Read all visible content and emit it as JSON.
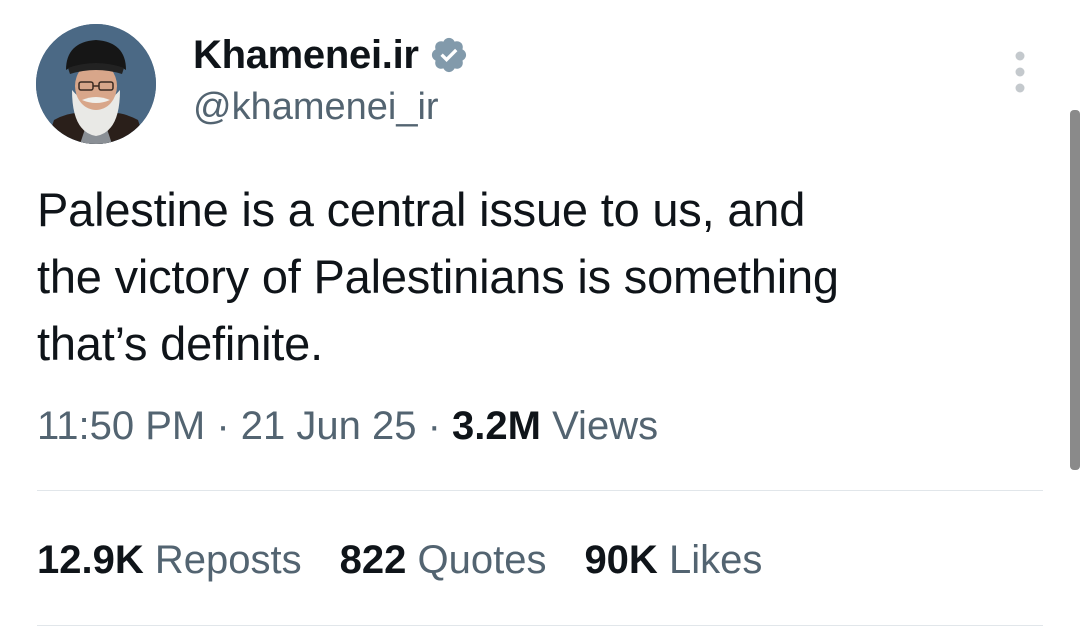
{
  "author": {
    "display_name": "Khamenei.ir",
    "handle": "@khamenei_ir",
    "verified": true,
    "verified_color": "#829aab"
  },
  "tweet": {
    "text_lines": [
      "Palestine is a central issue to us, and",
      "the victory of Palestinians is something",
      "that’s definite."
    ],
    "time": "11:50 PM",
    "sep1": " · ",
    "date": "21 Jun 25",
    "sep2": " · ",
    "views_count": "3.2M",
    "views_label": " Views"
  },
  "stats": {
    "reposts_count": "12.9K",
    "reposts_label": " Reposts",
    "quotes_count": "822",
    "quotes_label": " Quotes",
    "likes_count": "90K",
    "likes_label": " Likes"
  },
  "icons": {
    "avatar": "avatar",
    "verified": "verified-badge-icon",
    "more": "more-vertical-icon"
  },
  "colors": {
    "text_primary": "#0f1419",
    "text_secondary": "#536471",
    "divider": "#e1e6ea"
  }
}
